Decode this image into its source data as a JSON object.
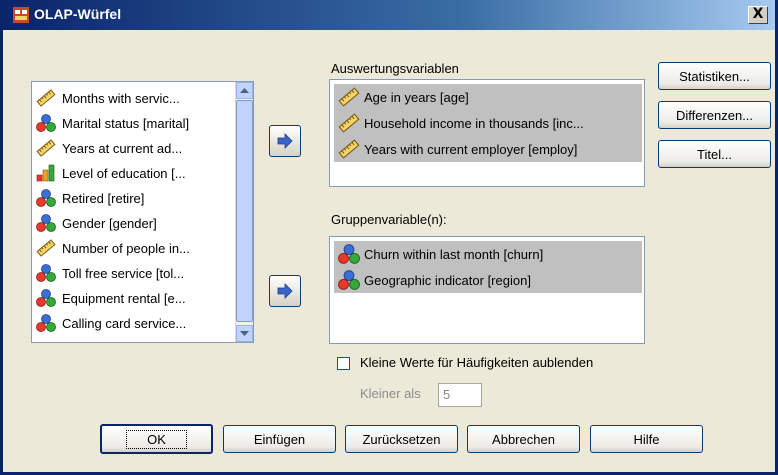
{
  "window": {
    "title": "OLAP-Würfel",
    "close_label": "X"
  },
  "source_list": {
    "items": [
      {
        "label": "Months with servic...",
        "icon": "scale-icon"
      },
      {
        "label": "Marital status [marital]",
        "icon": "nominal-icon"
      },
      {
        "label": "Years at current ad...",
        "icon": "scale-icon"
      },
      {
        "label": "Level of education [...",
        "icon": "ordinal-icon"
      },
      {
        "label": "Retired [retire]",
        "icon": "nominal-icon"
      },
      {
        "label": "Gender [gender]",
        "icon": "nominal-icon"
      },
      {
        "label": "Number of people in...",
        "icon": "scale-icon"
      },
      {
        "label": "Toll free service [tol...",
        "icon": "nominal-icon"
      },
      {
        "label": "Equipment rental [e...",
        "icon": "nominal-icon"
      },
      {
        "label": "Calling card service...",
        "icon": "nominal-icon"
      }
    ]
  },
  "summary_vars": {
    "label": "Auswertungsvariablen",
    "items": [
      {
        "label": "Age in years [age]",
        "icon": "scale-icon"
      },
      {
        "label": "Household income in thousands [inc...",
        "icon": "scale-icon"
      },
      {
        "label": "Years with current employer [employ]",
        "icon": "scale-icon"
      }
    ]
  },
  "group_vars": {
    "label": "Gruppenvariable(n):",
    "items": [
      {
        "label": "Churn within last month [churn]",
        "icon": "nominal-icon"
      },
      {
        "label": "Geographic indicator [region]",
        "icon": "nominal-icon"
      }
    ]
  },
  "side_buttons": {
    "statistics": "Statistiken...",
    "differences": "Differenzen...",
    "title": "Titel..."
  },
  "options": {
    "hide_small_counts": "Kleine Werte für Häufigkeiten aublenden",
    "smaller_than_label": "Kleiner als",
    "smaller_than_value": "5"
  },
  "bottom_buttons": {
    "ok": "OK",
    "paste": "Einfügen",
    "reset": "Zurücksetzen",
    "cancel": "Abbrechen",
    "help": "Hilfe"
  },
  "colors": {
    "title_bar": "#0a246a",
    "dialog_bg": "#ece9d8",
    "selection": "#c0c0c0",
    "arrow_blue": "#3a62c8"
  }
}
